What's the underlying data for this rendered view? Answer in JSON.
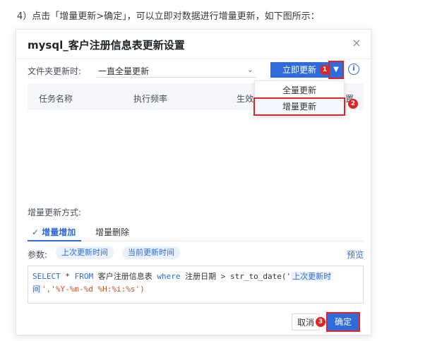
{
  "instruction": "4）点击「增量更新>确定」，可以立即对数据进行增量更新，如下图所示：",
  "dialog": {
    "title": "mysql_客户注册信息表更新设置",
    "close_icon": "×",
    "folder_update_label": "文件夹更新时:",
    "folder_update_value": "一直全量更新",
    "select_arrow": "⌄",
    "update_now_label": "立即更新",
    "dropdown_arrow": "▼",
    "info_icon": "i",
    "table_headers": [
      "任务名称",
      "执行频率",
      "生效状",
      "置"
    ],
    "dropdown_items": [
      "全量更新",
      "增量更新"
    ],
    "method_label": "增量更新方式:",
    "tabs": [
      {
        "label": "✓ 增量增加",
        "active": true
      },
      {
        "label": "增量删除",
        "active": false
      }
    ],
    "params_label": "参数:",
    "param_chips": [
      "上次更新时间",
      "当前更新时间"
    ],
    "preview_label": "预览",
    "sql": {
      "kw_select": "SELECT",
      "star": " * ",
      "kw_from": "FROM",
      "table": " 客户注册信息表 ",
      "kw_where": "where",
      "cond": " 注册日期 > str_to_date('",
      "param": "上次更新时间",
      "rest": "','%Y-%m-%d %H:%i:%s')"
    },
    "cancel_label": "取消",
    "ok_label": "确定"
  },
  "badges": [
    "1",
    "2",
    "3"
  ],
  "colors": {
    "accent": "#2f6bd9",
    "highlight": "#e02424"
  }
}
